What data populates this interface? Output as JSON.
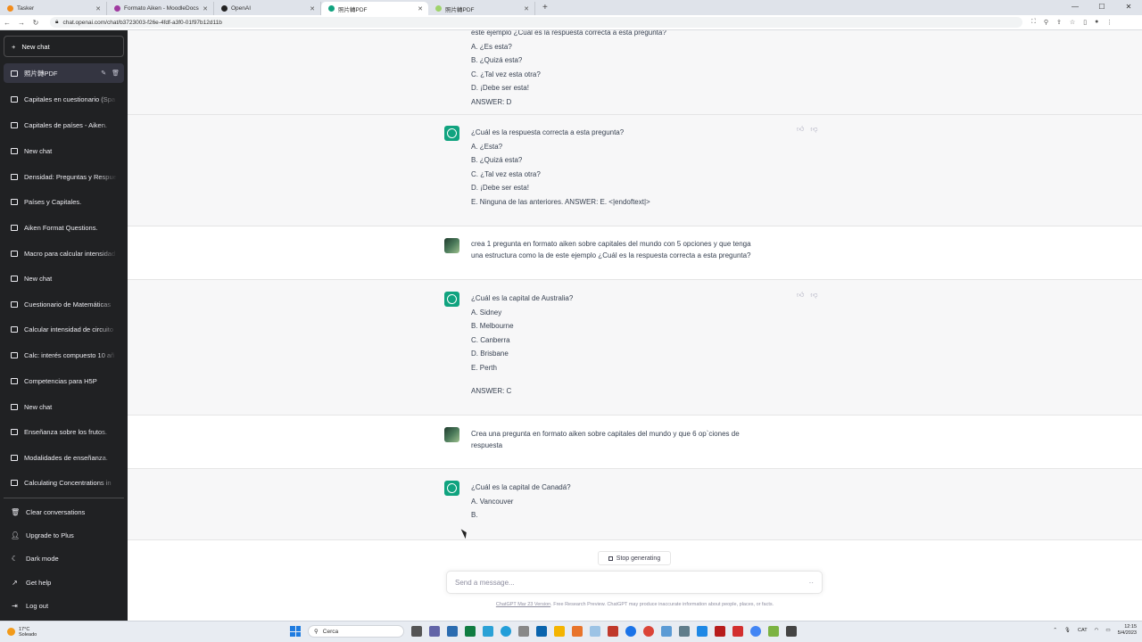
{
  "browser": {
    "tabs": [
      {
        "label": "Tasker",
        "color": "#f28b1a"
      },
      {
        "label": "Formato Aiken - MoodleDocs",
        "color": "#a03aa0"
      },
      {
        "label": "OpenAI",
        "color": "#222222"
      },
      {
        "label": "照片轉PDF",
        "color": "#10a37f"
      },
      {
        "label": "照片轉PDF",
        "color": "#9fd36b"
      }
    ],
    "new_tab": "+",
    "url": "chat.openai.com/chat/b3723003-f26e-4fdf-a3f0-01f97b12d11b"
  },
  "sidebar": {
    "new_chat": "New chat",
    "conversations": [
      "照片轉PDF",
      "Capitales en cuestionario (Spa",
      "Capitales de países - Aiken.",
      "New chat",
      "Densidad: Preguntas y Respue",
      "Países y Capitales.",
      "Aiken Format Questions.",
      "Macro para calcular intensidad",
      "New chat",
      "Cuestionario de Matemáticas",
      "Calcular intensidad de circuito",
      "Calc: interés compuesto 10 añ",
      "Competencias para H5P",
      "New chat",
      "Enseñanza sobre los frutos.",
      "Modalidades de enseñanza.",
      "Calculating Concentrations in"
    ],
    "bottom": {
      "clear": "Clear conversations",
      "upgrade": "Upgrade to Plus",
      "dark": "Dark mode",
      "help": "Get help",
      "logout": "Log out"
    }
  },
  "messages": {
    "m0": [
      "este ejemplo ¿Cuál es la respuesta correcta a esta pregunta?",
      "A. ¿Es esta?",
      "B. ¿Quizá esta?",
      "C. ¿Tal vez esta otra?",
      "D. ¡Debe ser esta!",
      "ANSWER: D"
    ],
    "m1": [
      "¿Cuál es la respuesta correcta a esta pregunta?",
      "A. ¿Esta?",
      "B. ¿Quizá esta?",
      "C. ¿Tal vez esta otra?",
      "D. ¡Debe ser esta!",
      "E. Ninguna de las anteriores. ANSWER: E. <|endoftext|>"
    ],
    "m2": [
      "crea 1 pregunta en formato aiken sobre capitales del mundo con 5 opciones y que tenga",
      "una estructura como la de este ejemplo ¿Cuál es la respuesta correcta a esta pregunta?"
    ],
    "m3": [
      "¿Cuál es la capital de Australia?",
      "A. Sidney",
      "B. Melbourne",
      "C. Canberra",
      "D. Brisbane",
      "E. Perth",
      "ANSWER: C"
    ],
    "m4": [
      "Crea una pregunta en formato aiken sobre capitales del mundo y que 6 op`ciones de",
      "respuesta"
    ],
    "m5": [
      "¿Cuál es la capital de Canadá?",
      "A. Vancouver",
      "B."
    ]
  },
  "composer": {
    "stop": "Stop generating",
    "placeholder": "Send a message...",
    "dots": "··",
    "footer_link": "ChatGPT Mar 23 Version",
    "footer_text": ". Free Research Preview. ChatGPT may produce inaccurate information about people, places, or facts."
  },
  "taskbar": {
    "temp": "17°C",
    "weather": "Soleado",
    "search": "Cerca",
    "lang": "CAT",
    "time": "12:15",
    "date": "5/4/2023"
  }
}
